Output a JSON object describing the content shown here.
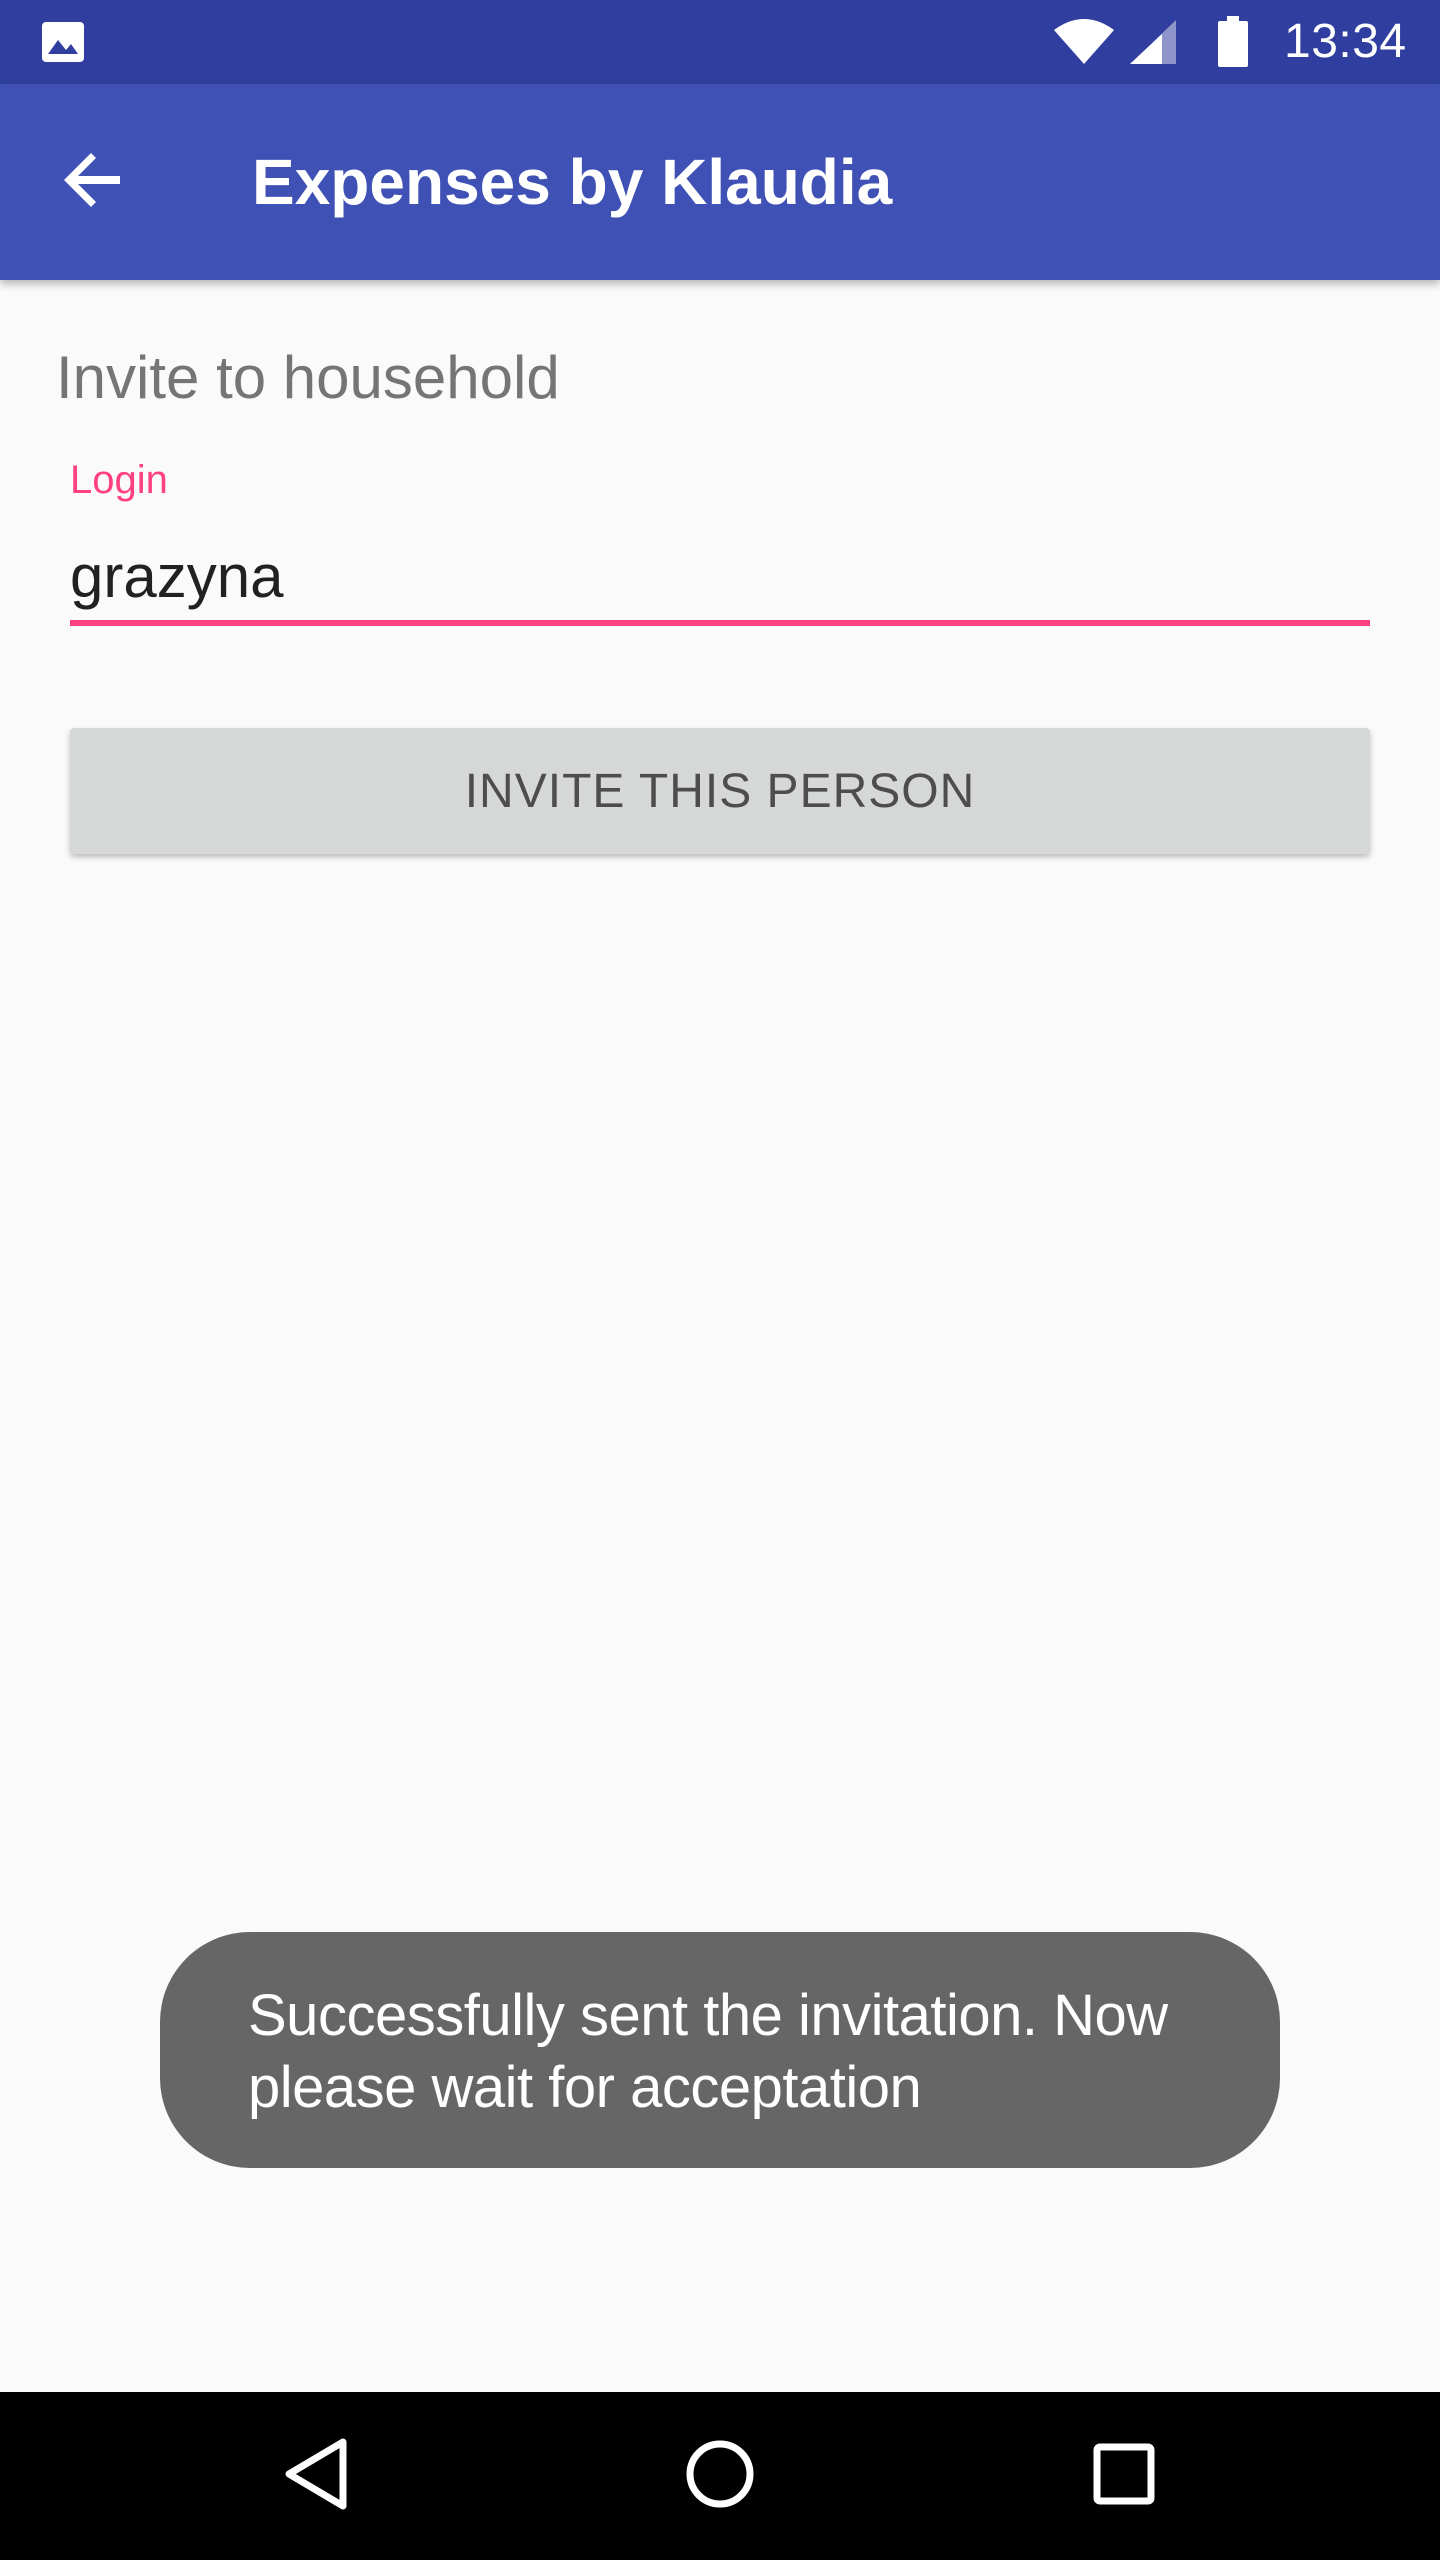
{
  "status_bar": {
    "time": "13:34",
    "icons": [
      "image-notification-icon",
      "wifi-icon",
      "cell-signal-icon",
      "battery-icon"
    ]
  },
  "app_bar": {
    "title": "Expenses by Klaudia",
    "back_icon": "arrow-back-icon"
  },
  "invite_form": {
    "heading": "Invite to household",
    "login_label": "Login",
    "login_value": "grazyna",
    "invite_button_label": "INVITE THIS PERSON"
  },
  "toast": {
    "message": "Successfully sent the invitation. Now please wait for acceptation"
  },
  "nav_bar": {
    "icons": [
      "nav-back-icon",
      "nav-home-icon",
      "nav-recents-icon"
    ]
  },
  "colors": {
    "status_bar": "#303f9f",
    "app_bar": "#3f51b5",
    "accent": "#ff4081",
    "background": "#fafafa",
    "button": "#d6d7d7",
    "toast": "#666666"
  }
}
